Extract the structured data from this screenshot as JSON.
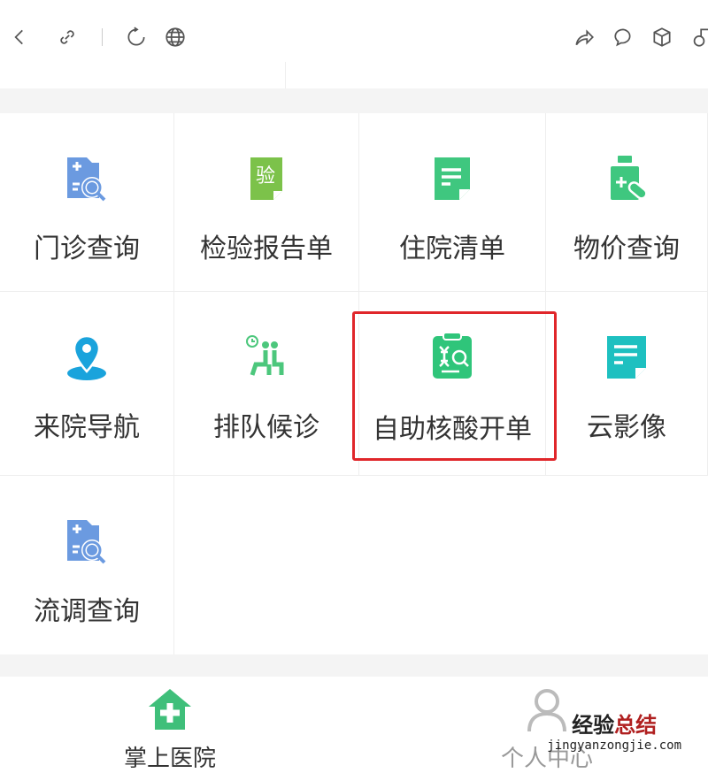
{
  "toolbar": {
    "icons": [
      "back-icon",
      "link-icon",
      "refresh-icon",
      "globe-icon",
      "share-icon",
      "chat-icon",
      "cube-icon",
      "mini-program-icon"
    ]
  },
  "grid": {
    "items": [
      {
        "label": "门诊查询",
        "icon": "doc-search-icon",
        "color": "#6b9ae0"
      },
      {
        "label": "检验报告单",
        "icon": "lab-report-icon",
        "color": "#7cc24a",
        "glyph": "验"
      },
      {
        "label": "住院清单",
        "icon": "list-doc-icon",
        "color": "#3fc77f"
      },
      {
        "label": "物价查询",
        "icon": "medicine-bottle-icon",
        "color": "#3fc77f"
      },
      {
        "label": "来院导航",
        "icon": "location-pin-icon",
        "color": "#1aa3dc"
      },
      {
        "label": "排队候诊",
        "icon": "waiting-queue-icon",
        "color": "#4cc77c"
      },
      {
        "label": "自助核酸开单",
        "icon": "dna-clipboard-icon",
        "color": "#2fc57a"
      },
      {
        "label": "云影像",
        "icon": "cloud-image-doc-icon",
        "color": "#1ec0c0"
      },
      {
        "label": "流调查询",
        "icon": "doc-search-icon",
        "color": "#6b9ae0"
      }
    ]
  },
  "nav": {
    "items": [
      {
        "label": "掌上医院",
        "color": "#3fbf7a"
      },
      {
        "label": "个人中心",
        "color": "#bbbbbb"
      }
    ]
  },
  "watermark": {
    "line1a": "经验",
    "line1b": "总结",
    "line2": "jingyanzongjie.com"
  },
  "highlight_color": "#e0262a"
}
